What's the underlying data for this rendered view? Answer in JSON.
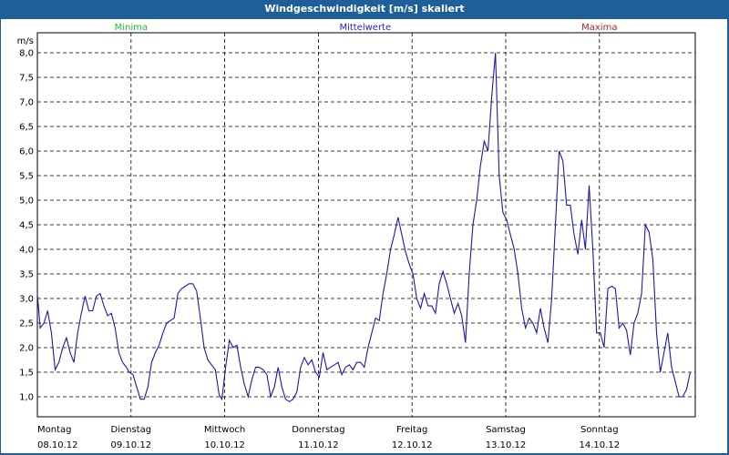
{
  "window": {
    "title": "Windgeschwindigkeit [m/s] skaliert"
  },
  "legend": {
    "minima": {
      "label": "Minima",
      "color": "#22bb22"
    },
    "mittelwerte": {
      "label": "Mittelwerte",
      "color": "#2222cc"
    },
    "maxima": {
      "label": "Maxima",
      "color": "#bb2222"
    }
  },
  "chart_data": {
    "type": "line",
    "title": "Windgeschwindigkeit [m/s] skaliert",
    "ylabel": "m/s",
    "xlabel": "",
    "ylim": [
      0.7,
      8.2
    ],
    "xlim": [
      0,
      7
    ],
    "grid": true,
    "y_ticks": [
      "1,0",
      "1,5",
      "2,0",
      "2,5",
      "3,0",
      "3,5",
      "4,0",
      "4,5",
      "5,0",
      "5,5",
      "6,0",
      "6,5",
      "7,0",
      "7,5",
      "8,0"
    ],
    "x_ticks": [
      {
        "day": "Montag",
        "date": "08.10.12"
      },
      {
        "day": "Dienstag",
        "date": "09.10.12"
      },
      {
        "day": "Mittwoch",
        "date": "10.10.12"
      },
      {
        "day": "Donnerstag",
        "date": "11.10.12"
      },
      {
        "day": "Freitag",
        "date": "12.10.12"
      },
      {
        "day": "Samstag",
        "date": "13.10.12"
      },
      {
        "day": "Sonntag",
        "date": "14.10.12"
      }
    ],
    "series": [
      {
        "name": "Mittelwerte",
        "color": "#1a1aaa",
        "points": [
          [
            0.0,
            3.1
          ],
          [
            0.03,
            2.4
          ],
          [
            0.07,
            2.5
          ],
          [
            0.11,
            2.75
          ],
          [
            0.15,
            2.3
          ],
          [
            0.19,
            1.55
          ],
          [
            0.23,
            1.7
          ],
          [
            0.27,
            2.0
          ],
          [
            0.31,
            2.2
          ],
          [
            0.35,
            1.9
          ],
          [
            0.39,
            1.7
          ],
          [
            0.43,
            2.3
          ],
          [
            0.47,
            2.7
          ],
          [
            0.51,
            3.05
          ],
          [
            0.55,
            2.75
          ],
          [
            0.59,
            2.75
          ],
          [
            0.63,
            3.05
          ],
          [
            0.67,
            3.1
          ],
          [
            0.71,
            2.85
          ],
          [
            0.75,
            2.65
          ],
          [
            0.79,
            2.7
          ],
          [
            0.83,
            2.4
          ],
          [
            0.87,
            1.9
          ],
          [
            0.91,
            1.7
          ],
          [
            0.95,
            1.6
          ],
          [
            0.98,
            1.5
          ],
          [
            1.02,
            1.45
          ],
          [
            1.06,
            1.2
          ],
          [
            1.1,
            0.95
          ],
          [
            1.14,
            0.95
          ],
          [
            1.18,
            1.2
          ],
          [
            1.22,
            1.7
          ],
          [
            1.26,
            1.9
          ],
          [
            1.3,
            2.05
          ],
          [
            1.34,
            2.3
          ],
          [
            1.38,
            2.5
          ],
          [
            1.42,
            2.55
          ],
          [
            1.46,
            2.6
          ],
          [
            1.5,
            3.1
          ],
          [
            1.54,
            3.2
          ],
          [
            1.58,
            3.25
          ],
          [
            1.62,
            3.3
          ],
          [
            1.66,
            3.3
          ],
          [
            1.7,
            3.15
          ],
          [
            1.74,
            2.6
          ],
          [
            1.78,
            2.0
          ],
          [
            1.82,
            1.75
          ],
          [
            1.86,
            1.65
          ],
          [
            1.9,
            1.55
          ],
          [
            1.94,
            1.05
          ],
          [
            1.97,
            0.95
          ],
          [
            2.01,
            1.6
          ],
          [
            2.05,
            2.15
          ],
          [
            2.09,
            2.0
          ],
          [
            2.13,
            2.05
          ],
          [
            2.17,
            1.6
          ],
          [
            2.21,
            1.25
          ],
          [
            2.25,
            1.0
          ],
          [
            2.29,
            1.35
          ],
          [
            2.33,
            1.6
          ],
          [
            2.37,
            1.6
          ],
          [
            2.41,
            1.55
          ],
          [
            2.45,
            1.45
          ],
          [
            2.49,
            1.0
          ],
          [
            2.53,
            1.2
          ],
          [
            2.57,
            1.6
          ],
          [
            2.61,
            1.2
          ],
          [
            2.65,
            0.95
          ],
          [
            2.69,
            0.9
          ],
          [
            2.73,
            0.95
          ],
          [
            2.77,
            1.1
          ],
          [
            2.81,
            1.6
          ],
          [
            2.85,
            1.8
          ],
          [
            2.89,
            1.65
          ],
          [
            2.93,
            1.75
          ],
          [
            2.97,
            1.5
          ],
          [
            3.01,
            1.4
          ],
          [
            3.05,
            1.9
          ],
          [
            3.09,
            1.55
          ],
          [
            3.13,
            1.6
          ],
          [
            3.17,
            1.65
          ],
          [
            3.21,
            1.7
          ],
          [
            3.25,
            1.45
          ],
          [
            3.29,
            1.6
          ],
          [
            3.33,
            1.65
          ],
          [
            3.37,
            1.55
          ],
          [
            3.41,
            1.7
          ],
          [
            3.45,
            1.7
          ],
          [
            3.49,
            1.6
          ],
          [
            3.53,
            2.0
          ],
          [
            3.57,
            2.3
          ],
          [
            3.61,
            2.6
          ],
          [
            3.65,
            2.55
          ],
          [
            3.69,
            3.1
          ],
          [
            3.73,
            3.5
          ],
          [
            3.77,
            4.0
          ],
          [
            3.81,
            4.3
          ],
          [
            3.85,
            4.65
          ],
          [
            3.89,
            4.3
          ],
          [
            3.93,
            3.95
          ],
          [
            3.97,
            3.7
          ],
          [
            4.01,
            3.5
          ],
          [
            4.05,
            3.0
          ],
          [
            4.09,
            2.8
          ],
          [
            4.13,
            3.1
          ],
          [
            4.17,
            2.85
          ],
          [
            4.21,
            2.85
          ],
          [
            4.25,
            2.7
          ],
          [
            4.29,
            3.3
          ],
          [
            4.33,
            3.55
          ],
          [
            4.37,
            3.3
          ],
          [
            4.41,
            3.0
          ],
          [
            4.45,
            2.7
          ],
          [
            4.49,
            2.9
          ],
          [
            4.53,
            2.65
          ],
          [
            4.57,
            2.1
          ],
          [
            4.61,
            3.5
          ],
          [
            4.65,
            4.5
          ],
          [
            4.69,
            5.0
          ],
          [
            4.73,
            5.7
          ],
          [
            4.77,
            6.2
          ],
          [
            4.81,
            6.0
          ],
          [
            4.85,
            7.1
          ],
          [
            4.89,
            8.0
          ],
          [
            4.93,
            5.5
          ],
          [
            4.97,
            4.75
          ],
          [
            5.01,
            4.6
          ],
          [
            5.05,
            4.3
          ],
          [
            5.09,
            4.0
          ],
          [
            5.13,
            3.5
          ],
          [
            5.17,
            2.8
          ],
          [
            5.21,
            2.4
          ],
          [
            5.25,
            2.6
          ],
          [
            5.29,
            2.5
          ],
          [
            5.33,
            2.3
          ],
          [
            5.37,
            2.8
          ],
          [
            5.41,
            2.4
          ],
          [
            5.45,
            2.1
          ],
          [
            5.49,
            3.0
          ],
          [
            5.53,
            4.5
          ],
          [
            5.57,
            6.0
          ],
          [
            5.61,
            5.8
          ],
          [
            5.65,
            4.9
          ],
          [
            5.69,
            4.9
          ],
          [
            5.73,
            4.3
          ],
          [
            5.77,
            3.9
          ],
          [
            5.81,
            4.6
          ],
          [
            5.85,
            4.0
          ],
          [
            5.89,
            5.3
          ],
          [
            5.93,
            4.0
          ],
          [
            5.97,
            2.3
          ],
          [
            6.01,
            2.3
          ],
          [
            6.05,
            2.0
          ],
          [
            6.09,
            3.2
          ],
          [
            6.13,
            3.25
          ],
          [
            6.17,
            3.2
          ],
          [
            6.21,
            2.4
          ],
          [
            6.25,
            2.5
          ],
          [
            6.29,
            2.35
          ],
          [
            6.33,
            1.85
          ],
          [
            6.37,
            2.5
          ],
          [
            6.41,
            2.7
          ],
          [
            6.45,
            3.1
          ],
          [
            6.49,
            4.5
          ],
          [
            6.53,
            4.35
          ],
          [
            6.57,
            3.8
          ],
          [
            6.61,
            2.3
          ],
          [
            6.65,
            1.5
          ],
          [
            6.69,
            1.9
          ],
          [
            6.73,
            2.3
          ],
          [
            6.77,
            1.6
          ],
          [
            6.81,
            1.3
          ],
          [
            6.85,
            1.0
          ],
          [
            6.89,
            1.0
          ],
          [
            6.93,
            1.15
          ],
          [
            6.97,
            1.5
          ]
        ]
      }
    ]
  }
}
